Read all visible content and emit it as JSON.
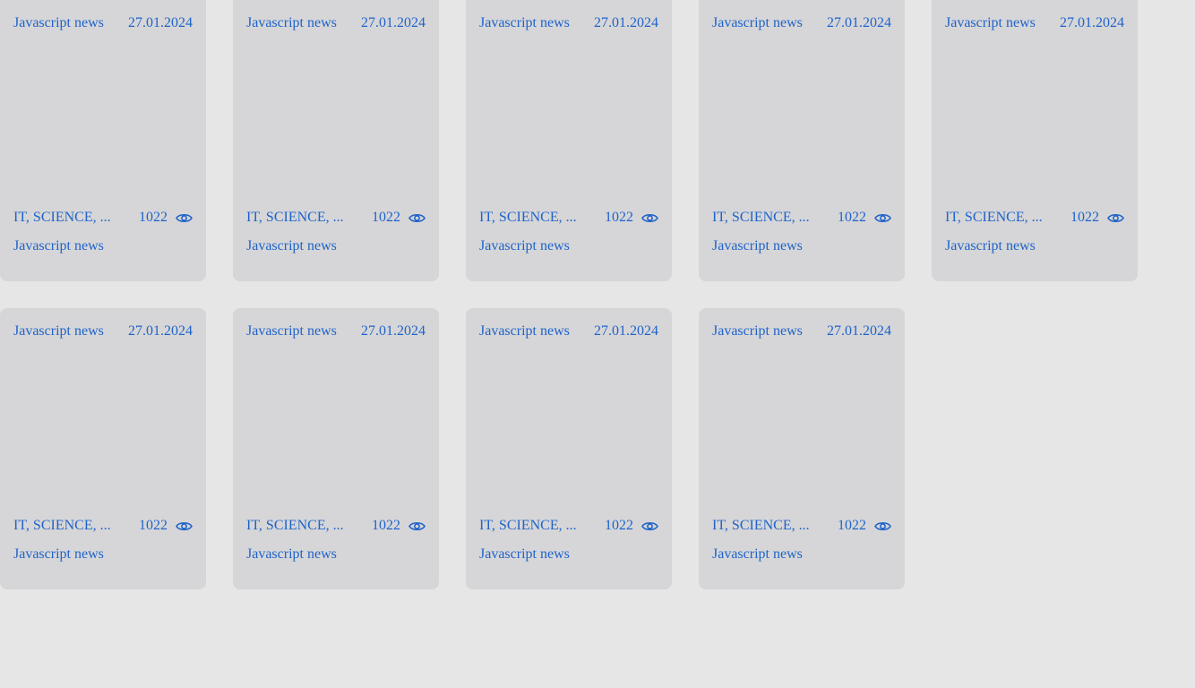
{
  "cards": [
    {
      "image_alt": "Javascript news",
      "date": "27.01.2024",
      "tags": "IT, SCIENCE, ...",
      "views": "1022",
      "title": "Javascript news"
    },
    {
      "image_alt": "Javascript news",
      "date": "27.01.2024",
      "tags": "IT, SCIENCE, ...",
      "views": "1022",
      "title": "Javascript news"
    },
    {
      "image_alt": "Javascript news",
      "date": "27.01.2024",
      "tags": "IT, SCIENCE, ...",
      "views": "1022",
      "title": "Javascript news"
    },
    {
      "image_alt": "Javascript news",
      "date": "27.01.2024",
      "tags": "IT, SCIENCE, ...",
      "views": "1022",
      "title": "Javascript news"
    },
    {
      "image_alt": "Javascript news",
      "date": "27.01.2024",
      "tags": "IT, SCIENCE, ...",
      "views": "1022",
      "title": "Javascript news"
    },
    {
      "image_alt": "Javascript news",
      "date": "27.01.2024",
      "tags": "IT, SCIENCE, ...",
      "views": "1022",
      "title": "Javascript news"
    },
    {
      "image_alt": "Javascript news",
      "date": "27.01.2024",
      "tags": "IT, SCIENCE, ...",
      "views": "1022",
      "title": "Javascript news"
    },
    {
      "image_alt": "Javascript news",
      "date": "27.01.2024",
      "tags": "IT, SCIENCE, ...",
      "views": "1022",
      "title": "Javascript news"
    },
    {
      "image_alt": "Javascript news",
      "date": "27.01.2024",
      "tags": "IT, SCIENCE, ...",
      "views": "1022",
      "title": "Javascript news"
    }
  ],
  "icons": {
    "views": "eye-icon"
  },
  "colors": {
    "link": "#1f63c9",
    "card_bg": "#d6d6d8",
    "page_bg": "#e6e6e7"
  }
}
